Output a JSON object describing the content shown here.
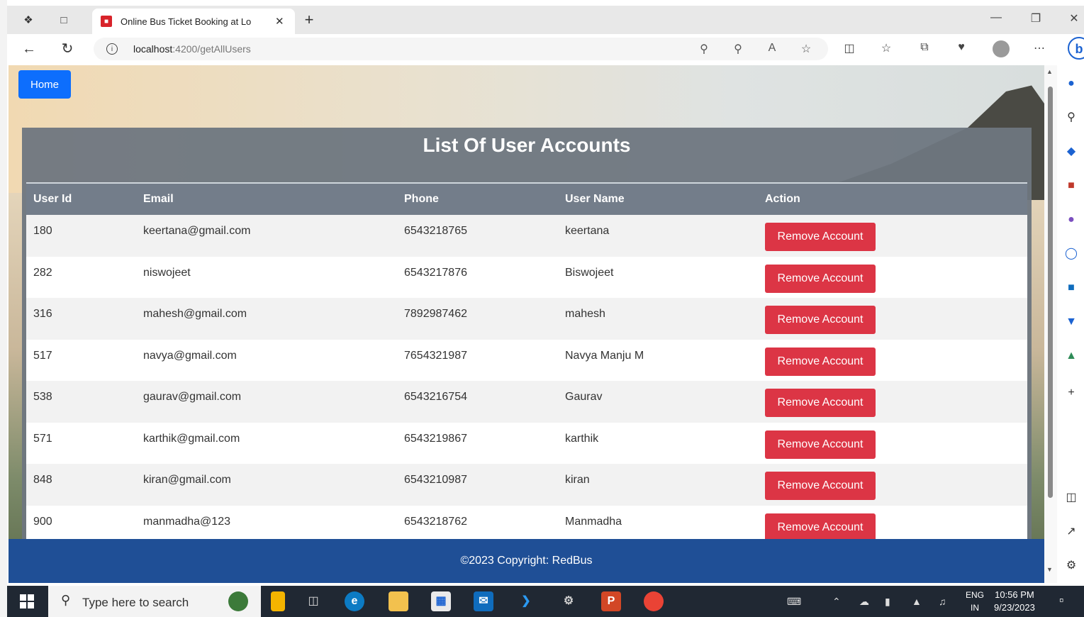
{
  "browser": {
    "tab_title": "Online Bus Ticket Booking at Lo",
    "url_host": "localhost",
    "url_path": ":4200/getAllUsers"
  },
  "page": {
    "home_label": "Home",
    "title": "List Of User Accounts",
    "columns": [
      "User Id",
      "Email",
      "Phone",
      "User Name",
      "Action"
    ],
    "rows": [
      {
        "id": "180",
        "email": "keertana@gmail.com",
        "phone": "6543218765",
        "name": "keertana",
        "action": "Remove Account"
      },
      {
        "id": "282",
        "email": "niswojeet",
        "phone": "6543217876",
        "name": "Biswojeet",
        "action": "Remove Account"
      },
      {
        "id": "316",
        "email": "mahesh@gmail.com",
        "phone": "7892987462",
        "name": "mahesh",
        "action": "Remove Account"
      },
      {
        "id": "517",
        "email": "navya@gmail.com",
        "phone": "7654321987",
        "name": "Navya Manju M",
        "action": "Remove Account"
      },
      {
        "id": "538",
        "email": "gaurav@gmail.com",
        "phone": "6543216754",
        "name": "Gaurav",
        "action": "Remove Account"
      },
      {
        "id": "571",
        "email": "karthik@gmail.com",
        "phone": "6543219867",
        "name": "karthik",
        "action": "Remove Account"
      },
      {
        "id": "848",
        "email": "kiran@gmail.com",
        "phone": "6543210987",
        "name": "kiran",
        "action": "Remove Account"
      },
      {
        "id": "900",
        "email": "manmadha@123",
        "phone": "6543218762",
        "name": "Manmadha",
        "action": "Remove Account"
      }
    ],
    "footer": "©2023 Copyright: RedBus"
  },
  "taskbar": {
    "search_placeholder": "Type here to search",
    "lang_top": "ENG",
    "lang_bottom": "IN",
    "time": "10:56 PM",
    "date": "9/23/2023"
  },
  "colors": {
    "primary_button": "#0d6efd",
    "danger_button": "#dc3545",
    "footer_bg": "#1f4f96",
    "card_bg": "#6e7680"
  }
}
